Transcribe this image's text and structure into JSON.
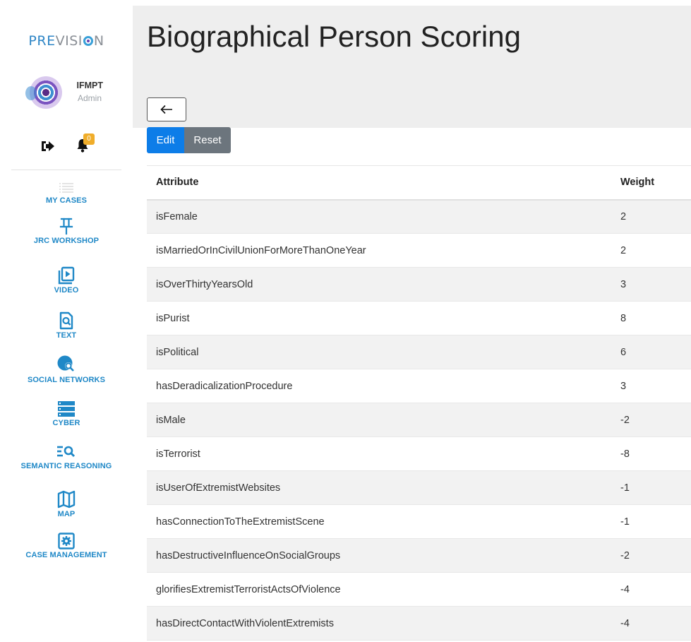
{
  "app": {
    "logo_part1": "PRE",
    "logo_part2": "VISI",
    "logo_part3": "N",
    "accent_color": "#1f88c7"
  },
  "user": {
    "name": "IFMPT",
    "role": "Admin",
    "notifications": "0"
  },
  "nav": {
    "items": [
      {
        "label": "MY CASES",
        "icon": "list-icon"
      },
      {
        "label": "JRC WORKSHOP",
        "icon": "pin-icon"
      },
      {
        "label": "VIDEO",
        "icon": "video-library-icon"
      },
      {
        "label": "TEXT",
        "icon": "document-search-icon"
      },
      {
        "label": "SOCIAL NETWORKS",
        "icon": "social-search-icon"
      },
      {
        "label": "CYBER",
        "icon": "server-icon"
      },
      {
        "label": "SEMANTIC REASONING",
        "icon": "list-search-icon"
      },
      {
        "label": "MAP",
        "icon": "map-icon"
      },
      {
        "label": "CASE MANAGEMENT",
        "icon": "gear-box-icon"
      }
    ]
  },
  "page": {
    "title": "Biographical Person Scoring",
    "back_icon": "arrow-left-icon"
  },
  "toolbar": {
    "edit_label": "Edit",
    "reset_label": "Reset"
  },
  "table": {
    "headers": [
      "Attribute",
      "Weight"
    ],
    "rows": [
      [
        "isFemale",
        "2"
      ],
      [
        "isMarriedOrInCivilUnionForMoreThanOneYear",
        "2"
      ],
      [
        "isOverThirtyYearsOld",
        "3"
      ],
      [
        "isPurist",
        "8"
      ],
      [
        "isPolitical",
        "6"
      ],
      [
        "hasDeradicalizationProcedure",
        "3"
      ],
      [
        "isMale",
        "-2"
      ],
      [
        "isTerrorist",
        "-8"
      ],
      [
        "isUserOfExtremistWebsites",
        "-1"
      ],
      [
        "hasConnectionToTheExtremistScene",
        "-1"
      ],
      [
        "hasDestructiveInfluenceOnSocialGroups",
        "-2"
      ],
      [
        "glorifiesExtremistTerroristActsOfViolence",
        "-4"
      ],
      [
        "hasDirectContactWithViolentExtremists",
        "-4"
      ]
    ]
  }
}
